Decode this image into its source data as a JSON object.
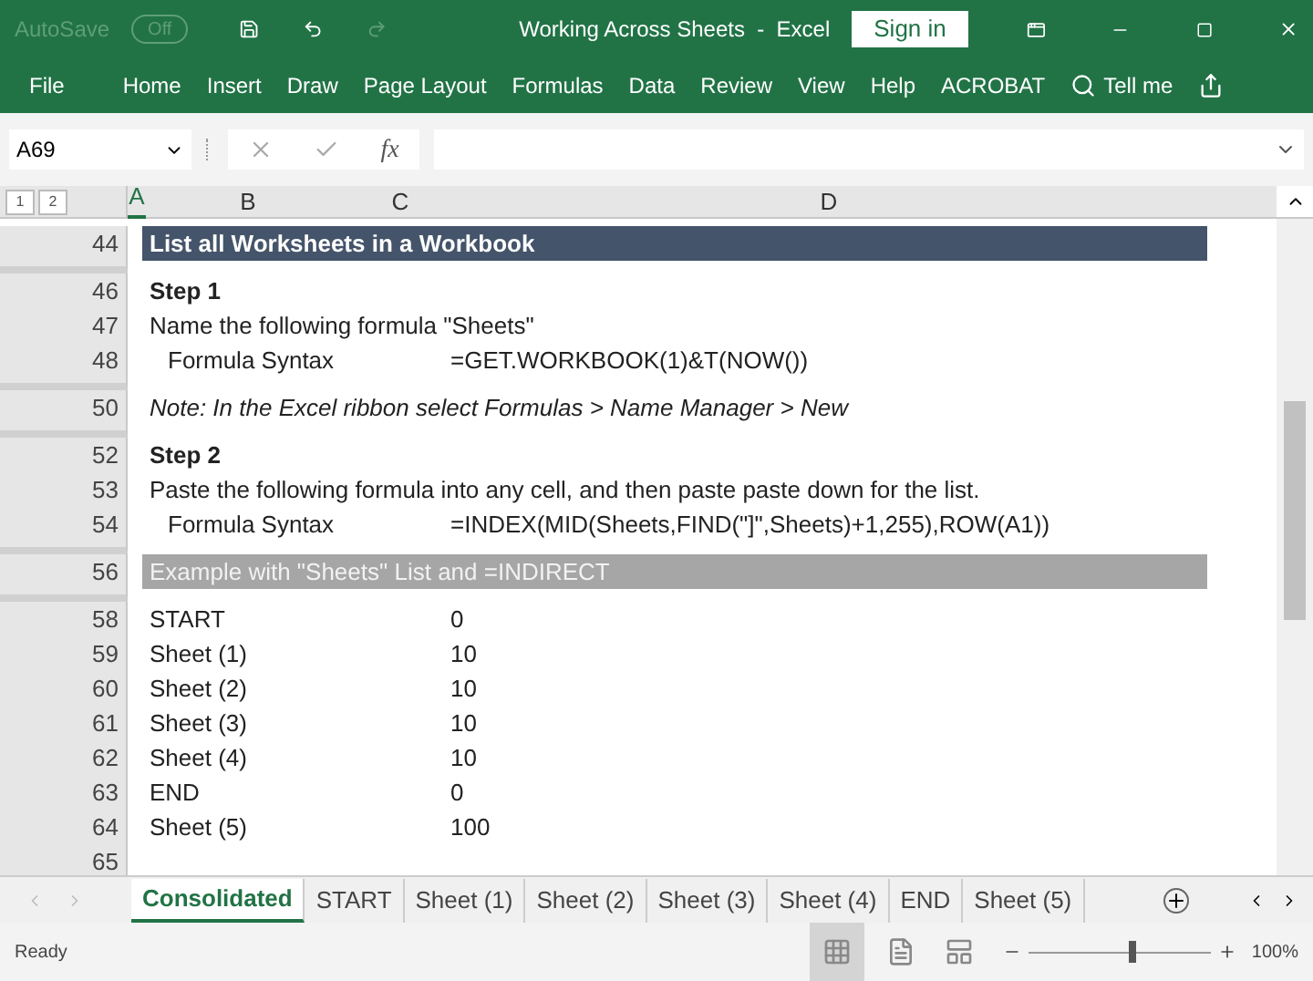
{
  "title_bar": {
    "autosave_label": "AutoSave",
    "autosave_state": "Off",
    "title": "Working Across Sheets  -  Excel",
    "sign_in": "Sign in"
  },
  "ribbon_tabs": [
    "File",
    "Home",
    "Insert",
    "Draw",
    "Page Layout",
    "Formulas",
    "Data",
    "Review",
    "View",
    "Help",
    "ACROBAT"
  ],
  "tell_me": "Tell me",
  "name_box": "A69",
  "formula_symbol": "fx",
  "outline_levels": [
    "1",
    "2"
  ],
  "columns": [
    "A",
    "B",
    "C",
    "D"
  ],
  "rows": [
    {
      "number": "44",
      "kind": "header",
      "text": "List all Worksheets in a Workbook",
      "after_hidden": true
    },
    {
      "number": "46",
      "kind": "bold",
      "text": "Step 1",
      "after_hidden": false
    },
    {
      "number": "47",
      "kind": "plain",
      "text": "Name the following formula \"Sheets\"",
      "after_hidden": false
    },
    {
      "number": "48",
      "kind": "formula",
      "text": "Formula Syntax",
      "value": "=GET.WORKBOOK(1)&T(NOW())",
      "after_hidden": true
    },
    {
      "number": "50",
      "kind": "italic",
      "text": "Note: In the Excel ribbon select Formulas > Name Manager > New",
      "after_hidden": true
    },
    {
      "number": "52",
      "kind": "bold",
      "text": "Step 2",
      "after_hidden": false
    },
    {
      "number": "53",
      "kind": "plain",
      "text": "Paste the following formula into any cell, and then paste paste down for the list.",
      "after_hidden": false
    },
    {
      "number": "54",
      "kind": "formula",
      "text": "Formula Syntax",
      "value": "=INDEX(MID(Sheets,FIND(\"]\",Sheets)+1,255),ROW(A1))",
      "after_hidden": true
    },
    {
      "number": "56",
      "kind": "subheader",
      "text": "Example with \"Sheets\" List and =INDIRECT",
      "after_hidden": true
    },
    {
      "number": "58",
      "kind": "data",
      "text": "START",
      "value": "0",
      "after_hidden": false
    },
    {
      "number": "59",
      "kind": "data",
      "text": "Sheet (1)",
      "value": "10",
      "after_hidden": false
    },
    {
      "number": "60",
      "kind": "data",
      "text": "Sheet (2)",
      "value": "10",
      "after_hidden": false
    },
    {
      "number": "61",
      "kind": "data",
      "text": "Sheet (3)",
      "value": "10",
      "after_hidden": false
    },
    {
      "number": "62",
      "kind": "data",
      "text": "Sheet (4)",
      "value": "10",
      "after_hidden": false
    },
    {
      "number": "63",
      "kind": "data",
      "text": "END",
      "value": "0",
      "after_hidden": false
    },
    {
      "number": "64",
      "kind": "data",
      "text": "Sheet (5)",
      "value": "100",
      "after_hidden": false
    },
    {
      "number": "65",
      "kind": "plain",
      "after_hidden": false
    }
  ],
  "sheet_tabs": [
    {
      "label": "Consolidated",
      "selected": true
    },
    {
      "label": "START",
      "selected": false
    },
    {
      "label": "Sheet (1)",
      "selected": false
    },
    {
      "label": "Sheet (2)",
      "selected": false
    },
    {
      "label": "Sheet (3)",
      "selected": false
    },
    {
      "label": "Sheet (4)",
      "selected": false
    },
    {
      "label": "END",
      "selected": false
    },
    {
      "label": "Sheet (5)",
      "selected": false
    }
  ],
  "status_bar": {
    "status": "Ready",
    "zoom_slider": {
      "level": 0.55
    },
    "zoom": "100%"
  }
}
